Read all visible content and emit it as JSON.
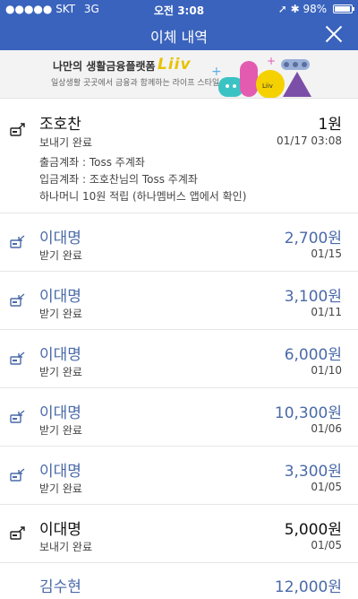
{
  "status_bar": {
    "carrier": "SKT",
    "network": "3G",
    "time": "오전 3:08",
    "battery": "98%"
  },
  "nav": {
    "title": "이체 내역"
  },
  "banner": {
    "headline": "나만의 생활금융플랫폼",
    "brand": "Liiv",
    "subtitle": "일상생활 곳곳에서 금융과 함께하는 라이프 스타일"
  },
  "transactions": [
    {
      "name": "조호찬",
      "status": "보내기 완료",
      "amount": "1원",
      "date": "01/17 03:08",
      "type": "send",
      "details": [
        "출금계좌 : Toss 주계좌",
        "입금계좌 : 조호찬님의 Toss 주계좌",
        "하나머니 10원 적립 (하나멤버스 앱에서 확인)"
      ]
    },
    {
      "name": "이대명",
      "status": "받기 완료",
      "amount": "2,700원",
      "date": "01/15",
      "type": "recv"
    },
    {
      "name": "이대명",
      "status": "받기 완료",
      "amount": "3,100원",
      "date": "01/11",
      "type": "recv"
    },
    {
      "name": "이대명",
      "status": "받기 완료",
      "amount": "6,000원",
      "date": "01/10",
      "type": "recv"
    },
    {
      "name": "이대명",
      "status": "받기 완료",
      "amount": "10,300원",
      "date": "01/06",
      "type": "recv"
    },
    {
      "name": "이대명",
      "status": "받기 완료",
      "amount": "3,300원",
      "date": "01/05",
      "type": "recv"
    },
    {
      "name": "이대명",
      "status": "보내기 완료",
      "amount": "5,000원",
      "date": "01/05",
      "type": "send"
    },
    {
      "name": "김수현",
      "status": "",
      "amount": "12,000원",
      "date": "",
      "type": "recv"
    }
  ],
  "colors": {
    "header": "#3a63bd",
    "received": "#4a6aa8",
    "sent": "#111111"
  },
  "icons": {
    "send": "send-transfer-icon",
    "recv": "receive-transfer-icon",
    "close": "close-icon"
  }
}
